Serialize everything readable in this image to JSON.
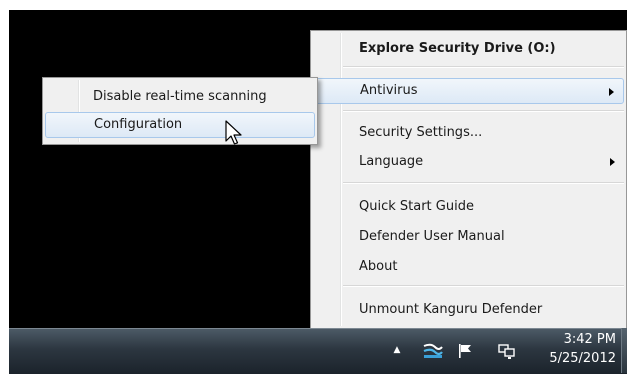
{
  "main_menu": {
    "items": [
      {
        "label": "Explore Security Drive (O:)"
      },
      {
        "label": "Antivirus"
      },
      {
        "label": "Security Settings..."
      },
      {
        "label": "Language"
      },
      {
        "label": "Quick Start Guide"
      },
      {
        "label": "Defender User Manual"
      },
      {
        "label": "About"
      },
      {
        "label": "Unmount Kanguru Defender"
      }
    ]
  },
  "submenu": {
    "items": [
      {
        "label": "Disable real-time scanning"
      },
      {
        "label": "Configuration"
      }
    ]
  },
  "taskbar": {
    "time": "3:42 PM",
    "date": "5/25/2012"
  },
  "icons": {
    "tray_expand": "chevron-up-icon",
    "defender_tray": "kanguru-defender-icon",
    "action_center": "flag-icon",
    "network": "network-icon",
    "submenu_arrow": "triangle-right-icon",
    "cursor": "mouse-pointer-icon"
  },
  "colors": {
    "menu_bg": "#f0f0f0",
    "highlight_border": "#a8c8eb",
    "desktop": "#000000"
  }
}
